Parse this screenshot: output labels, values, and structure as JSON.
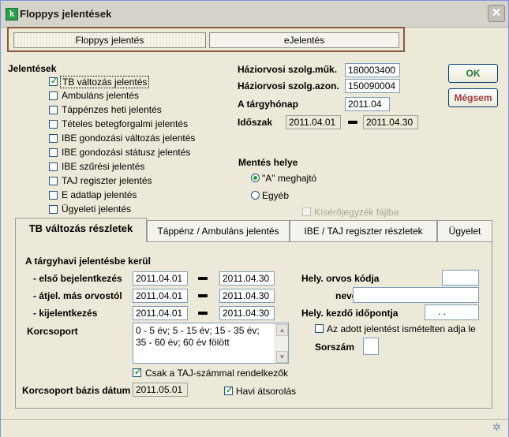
{
  "window": {
    "title": "Floppys jelentések",
    "close_glyph": "✕",
    "icon_glyph": "k"
  },
  "top_tabs": {
    "floppys": "Floppys jelentés",
    "ejelentes": "eJelentés"
  },
  "reports": {
    "heading": "Jelentések",
    "items": [
      {
        "label": "TB változás jelentés",
        "checked": true
      },
      {
        "label": "Ambuláns jelentés",
        "checked": false
      },
      {
        "label": "Táppénzes heti jelentés",
        "checked": false
      },
      {
        "label": "Tételes betegforgalmi jelentés",
        "checked": false
      },
      {
        "label": "IBE gondozási változás jelentés",
        "checked": false
      },
      {
        "label": "IBE gondozási státusz jelentés",
        "checked": false
      },
      {
        "label": "IBE szűrési jelentés",
        "checked": false
      },
      {
        "label": "TAJ regiszter jelentés",
        "checked": false
      },
      {
        "label": "E adatlap jelentés",
        "checked": false
      },
      {
        "label": "Ügyeleti jelentés",
        "checked": false
      }
    ]
  },
  "practice": {
    "muk_label": "Háziorvosi szolg.műk.",
    "muk_value": "180003400",
    "azon_label": "Háziorvosi szolg.azon.",
    "azon_value": "150090004",
    "month_label": "A tárgyhónap",
    "month_value": "2011.04",
    "period_label": "Időszak",
    "period_from": "2011.04.01",
    "period_to": "2011.04.30"
  },
  "buttons": {
    "ok": "OK",
    "cancel": "Mégsem"
  },
  "save_location": {
    "heading": "Mentés helye",
    "option_a": "\"A\" meghajtó",
    "option_other": "Egyéb",
    "selected": "a",
    "file_option": "Kísérőjegyzék fájlba"
  },
  "tabs": [
    {
      "label": "TB változás részletek",
      "active": true
    },
    {
      "label": "Táppénz / Ambuláns jelentés",
      "active": false
    },
    {
      "label": "IBE / TAJ regiszter részletek",
      "active": false
    },
    {
      "label": "Ügyelet",
      "active": false
    }
  ],
  "details": {
    "heading": "A tárgyhavi jelentésbe kerül",
    "rows": [
      {
        "label": "- első bejelentkezés",
        "from": "2011.04.01",
        "to": "2011.04.30"
      },
      {
        "label": "- átjel. más orvostól",
        "from": "2011.04.01",
        "to": "2011.04.30"
      },
      {
        "label": "- kijelentkezés",
        "from": "2011.04.01",
        "to": "2011.04.30"
      }
    ],
    "doctor_code_label": "Hely. orvos kódja",
    "doctor_code_value": "",
    "name_label": "neve",
    "name_value": "",
    "start_time_label": "Hely. kezdő időpontja",
    "start_time_value": ". .",
    "repeat_label": "Az adott jelentést ismételten adja le",
    "serial_label": "Sorszám",
    "serial_value": "",
    "age_group_label": "Korcsoport",
    "age_group_text": "0 - 5 év; 5 - 15 év; 15 - 35 év; 35 - 60 év; 60 év fölött",
    "taj_only_label": "Csak a TAJ-számmal rendelkezők",
    "taj_only_checked": true,
    "base_date_label": "Korcsoport bázis dátum",
    "base_date_value": "2011.05.01",
    "monthly_sort_label": "Havi átsorolás",
    "monthly_sort_checked": true
  }
}
